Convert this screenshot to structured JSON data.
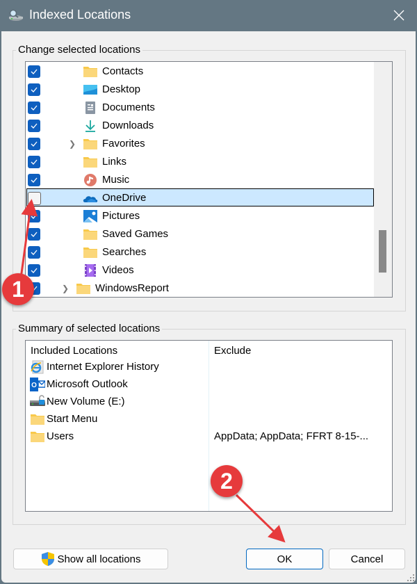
{
  "window": {
    "title": "Indexed Locations",
    "close_label": "Close"
  },
  "change_group": {
    "label": "Change selected locations",
    "items": [
      {
        "label": "Contacts",
        "checked": true,
        "expandable": false,
        "icon": "folder-icon",
        "indent": 1
      },
      {
        "label": "Desktop",
        "checked": true,
        "expandable": false,
        "icon": "desktop-icon",
        "indent": 1
      },
      {
        "label": "Documents",
        "checked": true,
        "expandable": false,
        "icon": "documents-icon",
        "indent": 1
      },
      {
        "label": "Downloads",
        "checked": true,
        "expandable": false,
        "icon": "download-icon",
        "indent": 1
      },
      {
        "label": "Favorites",
        "checked": true,
        "expandable": true,
        "icon": "folder-icon",
        "indent": 1
      },
      {
        "label": "Links",
        "checked": true,
        "expandable": false,
        "icon": "folder-icon",
        "indent": 1
      },
      {
        "label": "Music",
        "checked": true,
        "expandable": false,
        "icon": "music-icon",
        "indent": 1
      },
      {
        "label": "OneDrive",
        "checked": false,
        "expandable": false,
        "icon": "onedrive-icon",
        "indent": 1,
        "selected": true
      },
      {
        "label": "Pictures",
        "checked": true,
        "expandable": false,
        "icon": "pictures-icon",
        "indent": 1
      },
      {
        "label": "Saved Games",
        "checked": true,
        "expandable": false,
        "icon": "folder-icon",
        "indent": 1
      },
      {
        "label": "Searches",
        "checked": true,
        "expandable": false,
        "icon": "folder-icon",
        "indent": 1
      },
      {
        "label": "Videos",
        "checked": true,
        "expandable": false,
        "icon": "videos-icon",
        "indent": 1
      },
      {
        "label": "WindowsReport",
        "checked": true,
        "expandable": true,
        "icon": "folder-icon",
        "indent": 0
      }
    ]
  },
  "summary_group": {
    "label": "Summary of selected locations",
    "columns": {
      "included": "Included Locations",
      "exclude": "Exclude"
    },
    "rows": [
      {
        "included": "Internet Explorer History",
        "icon": "internet-explorer-icon",
        "exclude": ""
      },
      {
        "included": "Microsoft Outlook",
        "icon": "outlook-icon",
        "exclude": ""
      },
      {
        "included": "New Volume (E:)",
        "icon": "drive-icon",
        "exclude": ""
      },
      {
        "included": "Start Menu",
        "icon": "folder-icon",
        "exclude": ""
      },
      {
        "included": "Users",
        "icon": "folder-icon",
        "exclude": "AppData; AppData; FFRT 8-15-..."
      }
    ]
  },
  "buttons": {
    "show_all": "Show all locations",
    "ok": "OK",
    "cancel": "Cancel"
  },
  "annotations": {
    "badge1": "1",
    "badge2": "2"
  },
  "colors": {
    "titlebar": "#647783",
    "checkbox": "#0e5fbf",
    "selection": "#cce8ff",
    "badge": "#e63a3c"
  }
}
